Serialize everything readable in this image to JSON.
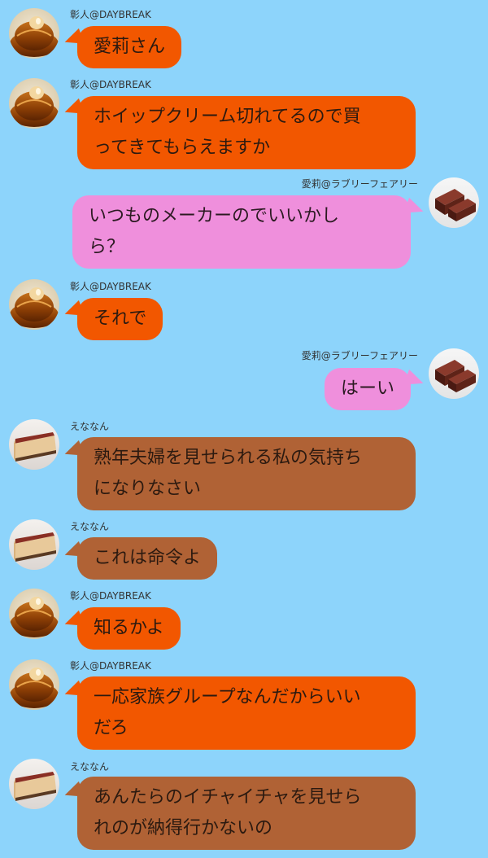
{
  "users": {
    "akihito": {
      "name": "彰人@DAYBREAK",
      "avatar": "caramel-cake-avatar"
    },
    "airi": {
      "name": "愛莉@ラブリーフェアリー",
      "avatar": "chocolate-yokan-avatar"
    },
    "enanan": {
      "name": "えななん",
      "avatar": "cheesecake-avatar"
    }
  },
  "colors": {
    "background": "#8dd4fb",
    "akihito_bubble": "#f25700",
    "airi_bubble": "#ef8fdc",
    "enanan_bubble": "#b06235"
  },
  "messages": [
    {
      "user": "彰人@DAYBREAK",
      "text": "愛莉さん"
    },
    {
      "user": "彰人@DAYBREAK",
      "text": "ホイップクリーム切れてるので買\nってきてもらえますか"
    },
    {
      "user": "愛莉@ラブリーフェアリー",
      "text": "いつものメーカーのでいいかし\nら？"
    },
    {
      "user": "彰人@DAYBREAK",
      "text": "それで"
    },
    {
      "user": "愛莉@ラブリーフェアリー",
      "text": "はーい"
    },
    {
      "user": "えななん",
      "text": "熟年夫婦を見せられる私の気持ち\nになりなさい"
    },
    {
      "user": "えななん",
      "text": "これは命令よ"
    },
    {
      "user": "彰人@DAYBREAK",
      "text": "知るかよ"
    },
    {
      "user": "彰人@DAYBREAK",
      "text": "一応家族グループなんだからいい\nだろ"
    },
    {
      "user": "えななん",
      "text": "あんたらのイチャイチャを見せら\nれのが納得行かないの"
    }
  ]
}
